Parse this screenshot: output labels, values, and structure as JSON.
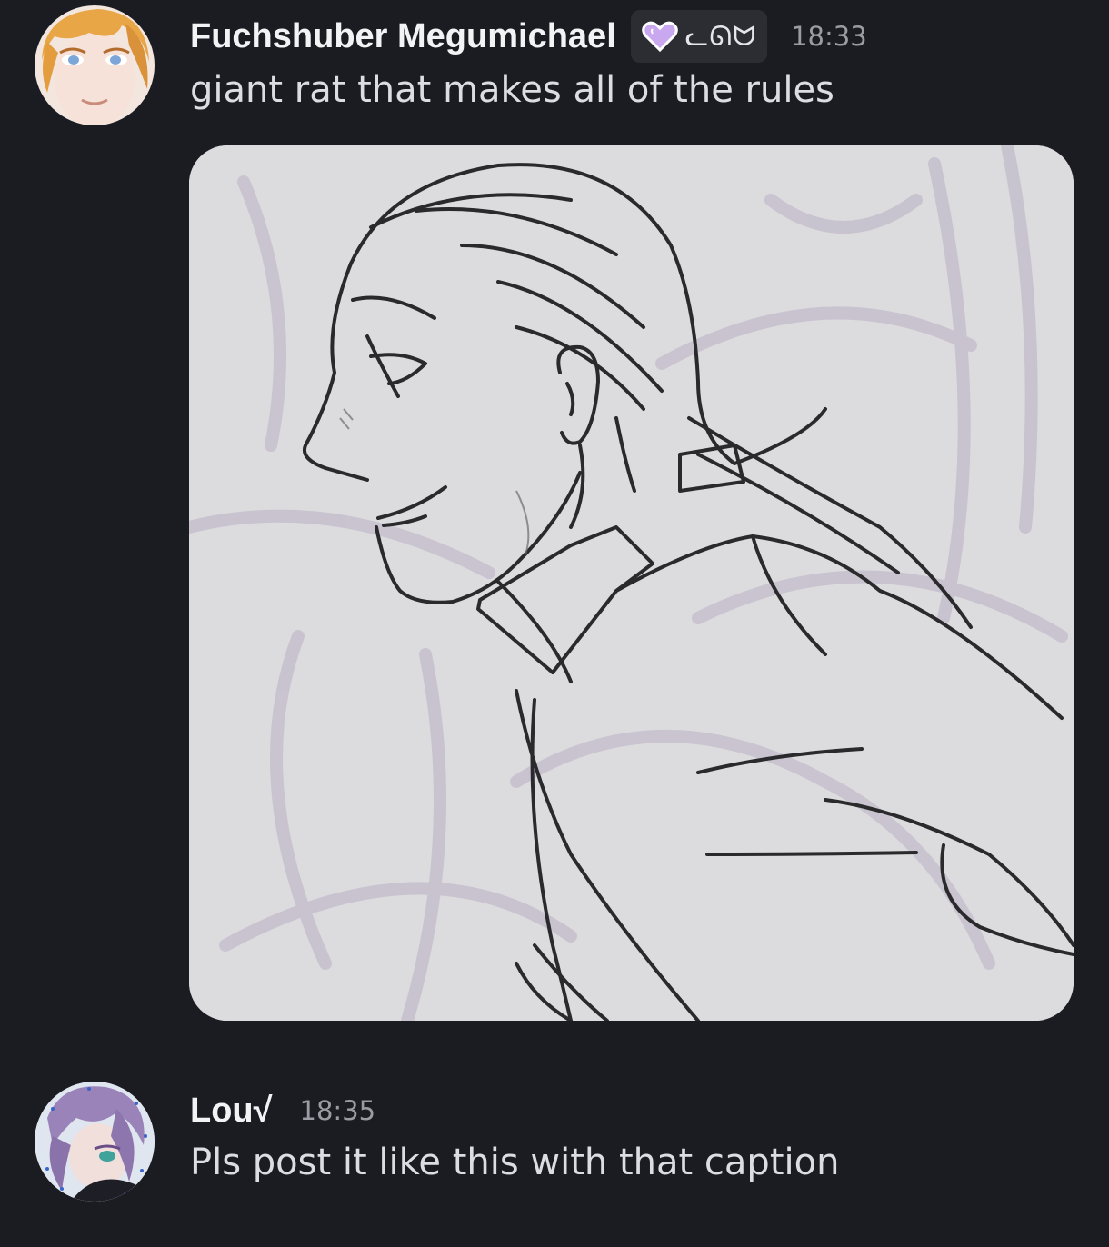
{
  "messages": [
    {
      "username": "Fuchshuber Megumichael",
      "guild_tag": "ᓚᘏᗢ",
      "tag_icon": "heart-icon",
      "timestamp": "18:33",
      "text": "giant rat that makes all of the rules",
      "attachment": "image"
    },
    {
      "username": "Lou√",
      "timestamp": "18:35",
      "text": "Pls post it like this with that caption"
    }
  ],
  "colors": {
    "background": "#1b1c21",
    "username": "#f2f3f5",
    "message_text": "#dcdde2",
    "timestamp": "#9a9ba3",
    "tag_background": "#2c2d33",
    "tag_heart": "#c9a8ef"
  }
}
